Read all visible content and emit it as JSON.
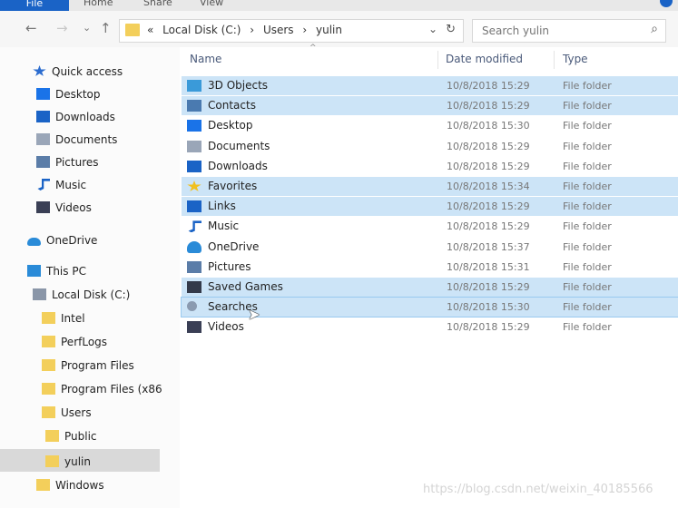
{
  "ribbon": {
    "file": "File",
    "home": "Home",
    "share": "Share",
    "view": "View"
  },
  "nav_buttons": {
    "back": "←",
    "forward": "→",
    "recent": "⌄",
    "up": "↑"
  },
  "address": {
    "root": "«",
    "crumbs": [
      "Local Disk (C:)",
      "›",
      "Users",
      "›",
      "yulin"
    ],
    "dropdown": "⌄",
    "refresh": "↻"
  },
  "search": {
    "placeholder": "Search yulin",
    "icon": "⌕"
  },
  "nav": [
    {
      "label": "Quick access",
      "icon": "star-icon",
      "color": "#2b6ccf",
      "pinned": false
    },
    {
      "label": "Desktop",
      "icon": "desktop-icon",
      "color": "#1a73e8",
      "pinned": true
    },
    {
      "label": "Downloads",
      "icon": "download-icon",
      "color": "#1a63c6",
      "pinned": true
    },
    {
      "label": "Documents",
      "icon": "document-icon",
      "color": "#9aa6b8",
      "pinned": true
    },
    {
      "label": "Pictures",
      "icon": "pictures-icon",
      "color": "#5b7da8",
      "pinned": true
    },
    {
      "label": "Music",
      "icon": "music-icon",
      "color": "#1a63c6",
      "pinned": false
    },
    {
      "label": "Videos",
      "icon": "videos-icon",
      "color": "#3a3f55",
      "pinned": false
    },
    {
      "label": "OneDrive",
      "icon": "cloud-icon",
      "color": "#2a8bd8",
      "pinned": false
    },
    {
      "label": "This PC",
      "icon": "pc-icon",
      "color": "#2a8bd8",
      "pinned": false
    },
    {
      "label": "Local Disk (C:)",
      "icon": "drive-icon",
      "color": "#8a96a8",
      "pinned": false
    },
    {
      "label": "Intel",
      "icon": "folder-icon",
      "color": "#f3cf5b",
      "pinned": false
    },
    {
      "label": "PerfLogs",
      "icon": "folder-icon",
      "color": "#f3cf5b",
      "pinned": false
    },
    {
      "label": "Program Files",
      "icon": "folder-icon",
      "color": "#f3cf5b",
      "pinned": false
    },
    {
      "label": "Program Files (x86",
      "icon": "folder-icon",
      "color": "#f3cf5b",
      "pinned": false
    },
    {
      "label": "Users",
      "icon": "folder-icon",
      "color": "#f3cf5b",
      "pinned": false
    },
    {
      "label": "Public",
      "icon": "folder-icon",
      "color": "#f3cf5b",
      "pinned": false
    },
    {
      "label": "yulin",
      "icon": "folder-icon",
      "color": "#f3cf5b",
      "pinned": false
    },
    {
      "label": "Windows",
      "icon": "folder-icon",
      "color": "#f3cf5b",
      "pinned": false
    }
  ],
  "columns": {
    "name": "Name",
    "date": "Date modified",
    "type": "Type",
    "sort": "^"
  },
  "files": [
    {
      "name": "3D Objects",
      "date": "10/8/2018 15:29",
      "type": "File folder",
      "icon": "3d-objects-icon",
      "color": "#3a9ad9",
      "selected": true
    },
    {
      "name": "Contacts",
      "date": "10/8/2018 15:29",
      "type": "File folder",
      "icon": "contacts-icon",
      "color": "#4a7ab0",
      "selected": true
    },
    {
      "name": "Desktop",
      "date": "10/8/2018 15:30",
      "type": "File folder",
      "icon": "desktop-icon",
      "color": "#1a73e8",
      "selected": false
    },
    {
      "name": "Documents",
      "date": "10/8/2018 15:29",
      "type": "File folder",
      "icon": "document-icon",
      "color": "#9aa6b8",
      "selected": false
    },
    {
      "name": "Downloads",
      "date": "10/8/2018 15:29",
      "type": "File folder",
      "icon": "download-icon",
      "color": "#1a63c6",
      "selected": false
    },
    {
      "name": "Favorites",
      "date": "10/8/2018 15:34",
      "type": "File folder",
      "icon": "favorites-star-icon",
      "color": "#f0c020",
      "selected": true
    },
    {
      "name": "Links",
      "date": "10/8/2018 15:29",
      "type": "File folder",
      "icon": "links-icon",
      "color": "#1a63c6",
      "selected": true
    },
    {
      "name": "Music",
      "date": "10/8/2018 15:29",
      "type": "File folder",
      "icon": "music-icon",
      "color": "#1a63c6",
      "selected": false
    },
    {
      "name": "OneDrive",
      "date": "10/8/2018 15:37",
      "type": "File folder",
      "icon": "cloud-icon",
      "color": "#2a8bd8",
      "selected": false
    },
    {
      "name": "Pictures",
      "date": "10/8/2018 15:31",
      "type": "File folder",
      "icon": "pictures-icon",
      "color": "#5b7da8",
      "selected": false
    },
    {
      "name": "Saved Games",
      "date": "10/8/2018 15:29",
      "type": "File folder",
      "icon": "gamepad-icon",
      "color": "#333a4a",
      "selected": true
    },
    {
      "name": "Searches",
      "date": "10/8/2018 15:30",
      "type": "File folder",
      "icon": "search-icon",
      "color": "#8a9ab0",
      "selected": true,
      "focused": true
    },
    {
      "name": "Videos",
      "date": "10/8/2018 15:29",
      "type": "File folder",
      "icon": "videos-icon",
      "color": "#3a3f55",
      "selected": false
    }
  ],
  "watermark": "https://blog.csdn.net/weixin_40185566",
  "cursor": "➤"
}
